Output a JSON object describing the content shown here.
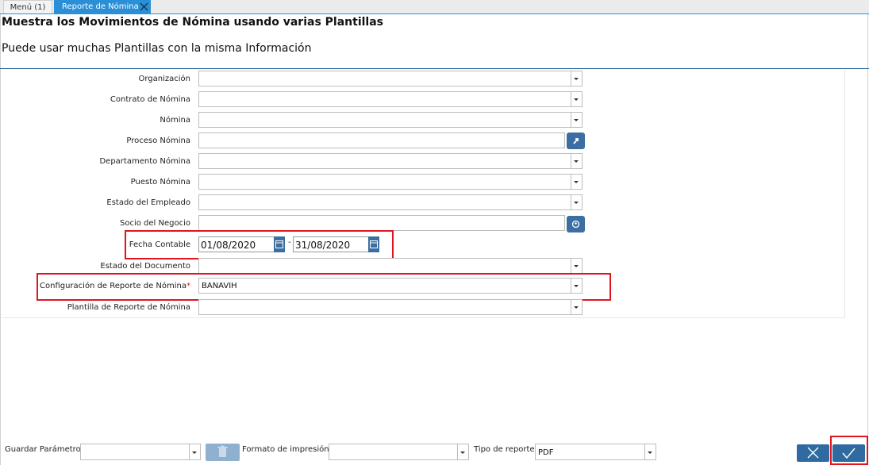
{
  "tabs": [
    {
      "label": "Menú (1)"
    },
    {
      "label": "Reporte de Nómina"
    }
  ],
  "header": {
    "title": "Muestra los Movimientos de Nómina usando varias Plantillas",
    "subtitle": "Puede usar muchas Plantillas con la misma Información"
  },
  "form": {
    "organizacion": {
      "label": "Organización",
      "value": ""
    },
    "contrato": {
      "label": "Contrato de Nómina",
      "value": ""
    },
    "nomina": {
      "label": "Nómina",
      "value": ""
    },
    "proceso": {
      "label": "Proceso Nómina",
      "value": ""
    },
    "departamento": {
      "label": "Departamento Nómina",
      "value": ""
    },
    "puesto": {
      "label": "Puesto Nómina",
      "value": ""
    },
    "estado_empleado": {
      "label": "Estado del Empleado",
      "value": ""
    },
    "socio": {
      "label": "Socio del Negocio",
      "value": ""
    },
    "fecha": {
      "label": "Fecha Contable",
      "from": "01/08/2020",
      "separator": "-",
      "to": "31/08/2020"
    },
    "estado_documento": {
      "label": "Estado del Documento",
      "value": ""
    },
    "configuracion": {
      "label": "Configuración de Reporte de Nómina",
      "required_mark": "*",
      "value": "BANAVIH"
    },
    "plantilla": {
      "label": "Plantilla de Reporte de Nómina",
      "value": ""
    }
  },
  "footer": {
    "guardar_label": "Guardar Parámetro",
    "guardar_value": "",
    "formato_label": "Formato de impresión",
    "formato_value": "",
    "tipo_label": "Tipo de reporte",
    "tipo_value": "PDF"
  },
  "colors": {
    "accent": "#2a8fd6",
    "button": "#3b6fa1",
    "highlight": "#e0161e"
  }
}
